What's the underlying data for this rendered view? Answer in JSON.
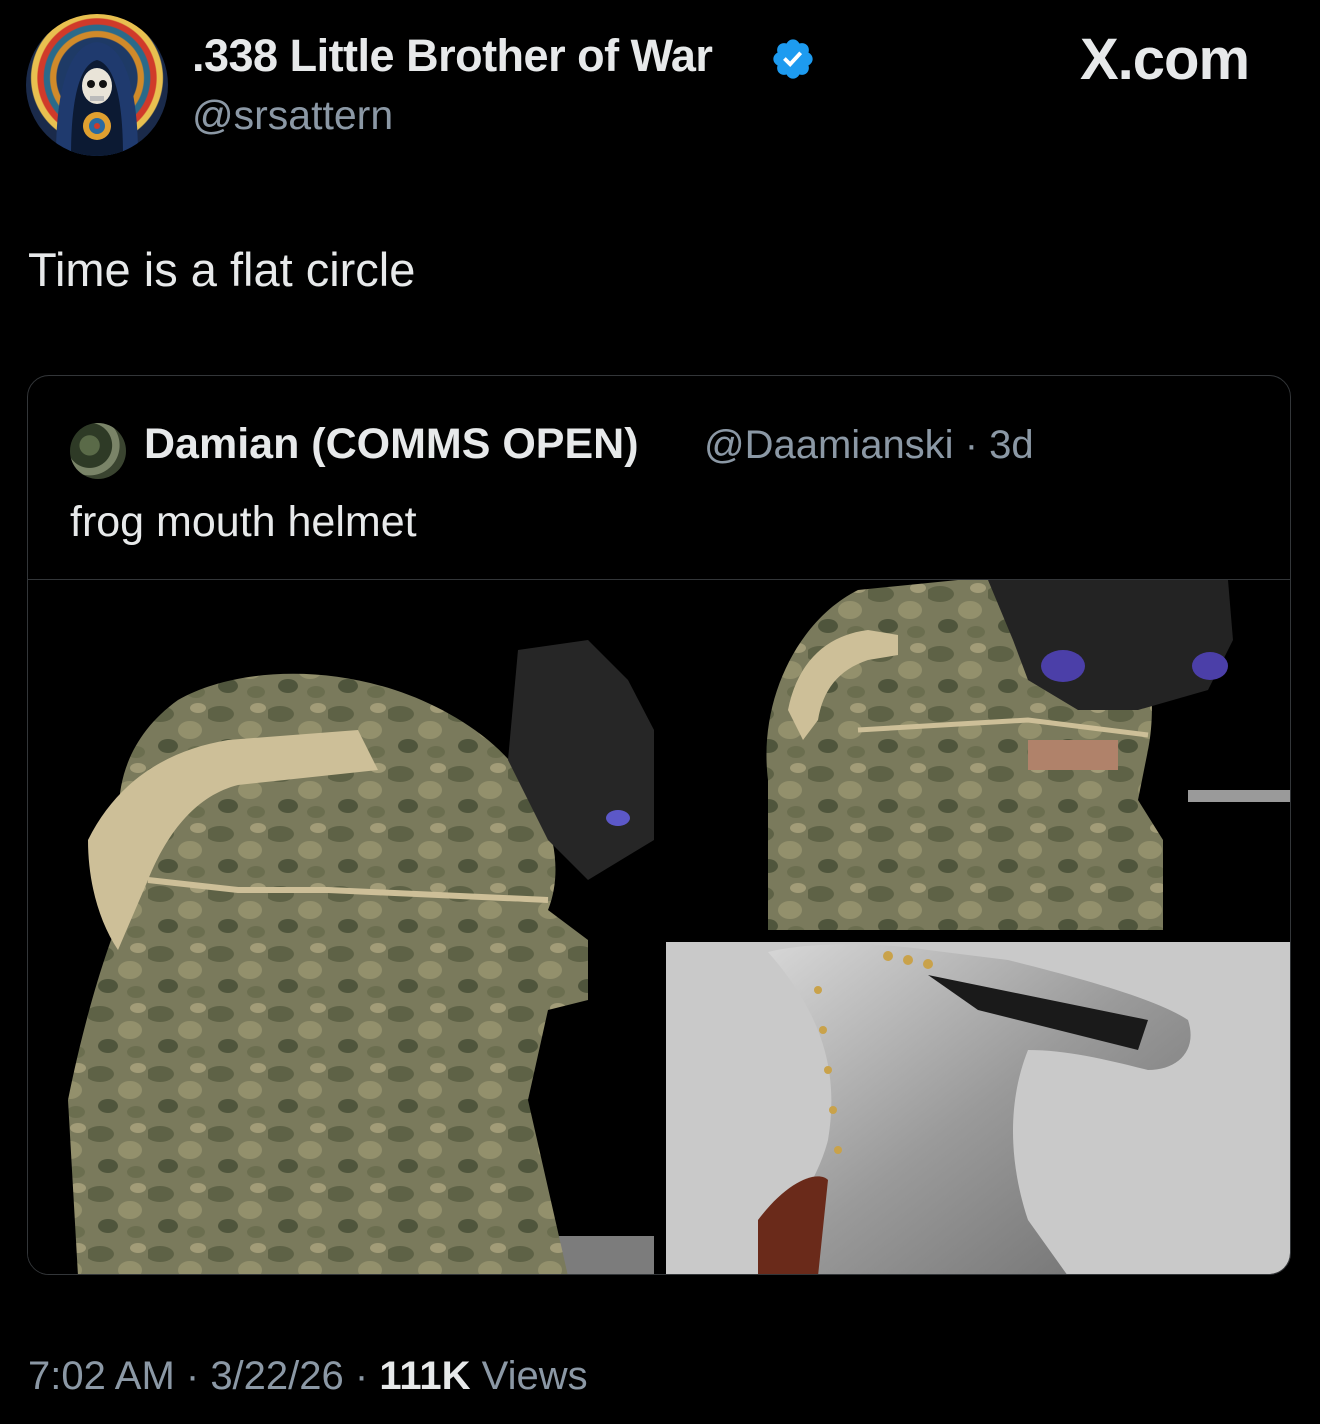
{
  "author": {
    "display_name": ".338 Little Brother of War",
    "handle": "@srsattern",
    "verified_icon": "verified-badge-icon",
    "accent_color": "#1d9bf0"
  },
  "brand": {
    "label": "X.com"
  },
  "tweet": {
    "text": "Time is a flat circle"
  },
  "quoted_tweet": {
    "display_name": "Damian (COMMS OPEN)",
    "handle": "@Daamianski",
    "separator": " · ",
    "age": "3d",
    "text": "frog mouth helmet",
    "media": [
      {
        "description_icon": "camo-helmet-side-image"
      },
      {
        "description_icon": "camo-helmet-front-image"
      },
      {
        "description_icon": "frog-mouth-helm-image"
      }
    ]
  },
  "footer": {
    "time": "7:02 AM",
    "sep1": " · ",
    "date": "3/22/26",
    "sep2": " · ",
    "views_count": "111K",
    "views_label": " Views"
  }
}
